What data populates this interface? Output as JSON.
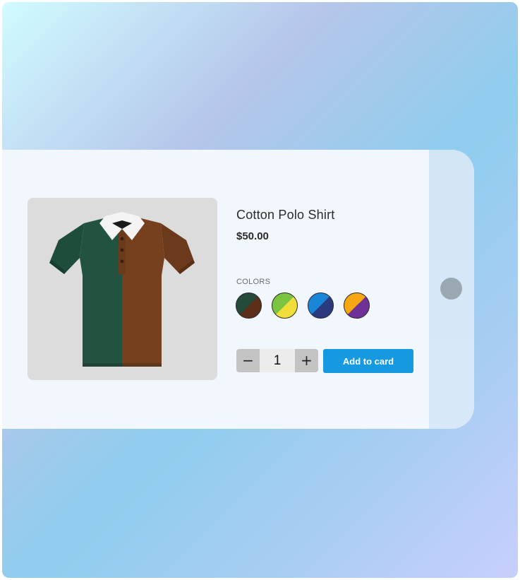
{
  "product": {
    "title": "Cotton Polo Shirt",
    "price": "$50.00",
    "image_alt": "polo shirt with green left half and brown right half, white collar"
  },
  "colors": {
    "label": "COLORS",
    "swatches": [
      {
        "name": "green-brown",
        "top": "#244a3a",
        "bottom": "#5d2f1a"
      },
      {
        "name": "lime-yellow",
        "top": "#7ac43f",
        "bottom": "#f2de3a"
      },
      {
        "name": "blue-navy",
        "top": "#1a86d8",
        "bottom": "#2b3a7e"
      },
      {
        "name": "orange-purple",
        "top": "#f7a712",
        "bottom": "#6f3196"
      }
    ]
  },
  "quantity": {
    "minus_label": "−",
    "value": "1",
    "plus_label": "+"
  },
  "actions": {
    "add_label": "Add to card"
  },
  "theme": {
    "accent": "#1599e1",
    "card_bg": "#f1f7fd",
    "image_bg": "#dcdcdc"
  }
}
